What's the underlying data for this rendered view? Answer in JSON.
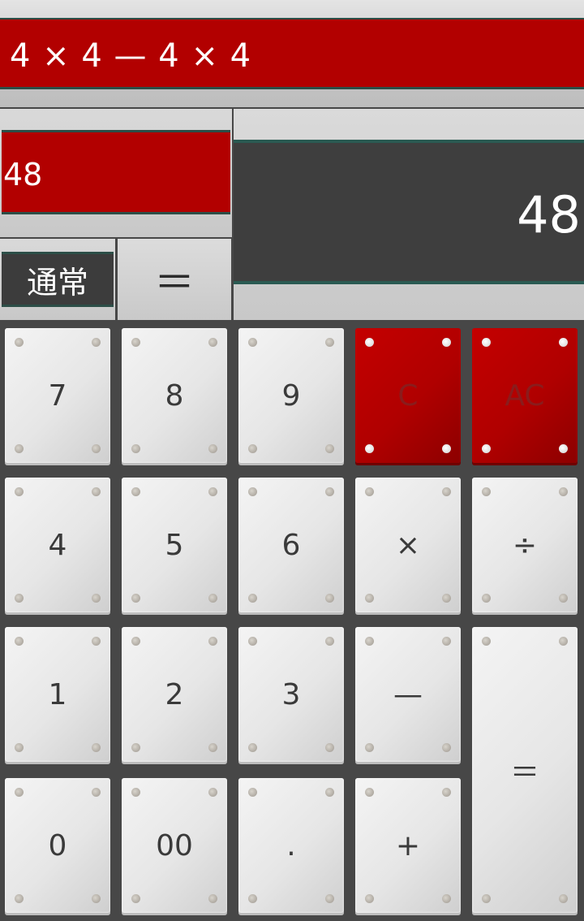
{
  "display": {
    "expression": "4 × 4 — 4 × 4",
    "memory_value": "48",
    "mode_label": "通常",
    "small_equals_label": "＝",
    "result_value": "48"
  },
  "keys": {
    "k7": "7",
    "k8": "8",
    "k9": "9",
    "clear": "C",
    "all_clear": "AC",
    "k4": "4",
    "k5": "5",
    "k6": "6",
    "multiply": "×",
    "divide": "÷",
    "k1": "1",
    "k2": "2",
    "k3": "3",
    "minus": "—",
    "equals": "＝",
    "k0": "0",
    "k00": "00",
    "dot": ".",
    "plus": "+"
  },
  "colors": {
    "accent_red": "#b20000",
    "screen_dark": "#3e3e3e",
    "background": "#474747"
  }
}
